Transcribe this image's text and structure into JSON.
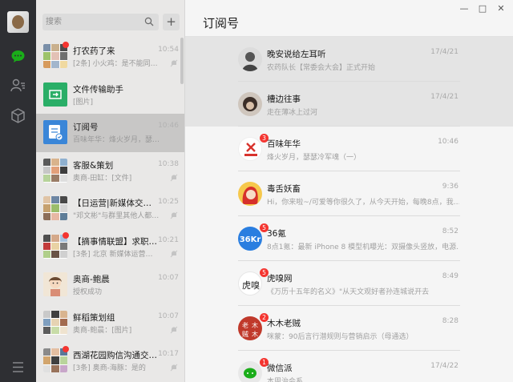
{
  "sidebar": {
    "icons": [
      "avatar",
      "chat-icon",
      "contacts-icon",
      "favorites-icon",
      "menu-icon"
    ]
  },
  "search": {
    "placeholder": "搜索"
  },
  "add_button": "+",
  "conversations": [
    {
      "name": "打农药了来",
      "preview": "[2条] 小火鸡：是不能同…",
      "time": "10:54",
      "muted": true,
      "dot": true
    },
    {
      "name": "文件传输助手",
      "preview": "[图片]",
      "time": "",
      "muted": false,
      "dot": false
    },
    {
      "name": "订阅号",
      "preview": "百味年华：烽火岁月，瑟…",
      "time": "10:46",
      "muted": false,
      "dot": false,
      "selected": true
    },
    {
      "name": "客服&策划",
      "preview": "奥商-田缸：[文件]",
      "time": "10:38",
      "muted": true,
      "dot": false
    },
    {
      "name": "【日运营|新媒体交…",
      "preview": "\"邓文彬\"与群里其他人都…",
      "time": "10:25",
      "muted": true,
      "dot": false
    },
    {
      "name": "【摘事情联盟】求职…",
      "preview": "[3条] 北京 新媒体运营…",
      "time": "10:21",
      "muted": true,
      "dot": true
    },
    {
      "name": "奥商-鲍晨",
      "preview": "授权成功",
      "time": "10:07",
      "muted": false,
      "dot": false
    },
    {
      "name": "鲜稻策划组",
      "preview": "奥商-鲍晨：[图片]",
      "time": "10:07",
      "muted": true,
      "dot": false
    },
    {
      "name": "西湖花园购信沟通交…",
      "preview": "[3条] 奥商-海豚：是的",
      "time": "10:17",
      "muted": true,
      "dot": true
    }
  ],
  "window_controls": [
    "—",
    "□",
    "✕"
  ],
  "main": {
    "title": "订阅号",
    "accounts": [
      {
        "name": "晚安说给左耳听",
        "message": "农药队长【常委会大会】正式开始",
        "time": "17/4/21",
        "badge": ""
      },
      {
        "name": "槽边往事",
        "message": "走在薄冰上过河",
        "time": "17/4/21",
        "badge": ""
      },
      {
        "name": "百味年华",
        "message": "烽火岁月，瑟瑟冷军魂（一）",
        "time": "10:46",
        "badge": "3"
      },
      {
        "name": "毒舌妖畜",
        "message": "Hi，你来啦~/可爱等你很久了，从今天开始，每晚8点，我…",
        "time": "9:36",
        "badge": ""
      },
      {
        "name": "36氪",
        "message": "8点1氪：最新 iPhone 8 模型机曝光：双摄像头竖放，电源…",
        "time": "8:52",
        "badge": "5"
      },
      {
        "name": "虎嗅网",
        "message": "《万历十五年的名义》\"从天文观好者孙连城说开去",
        "time": "8:49",
        "badge": "5"
      },
      {
        "name": "木木老贼",
        "message": "咪蒙：90后言行潜规则与营销启示（母通选）",
        "time": "8:28",
        "badge": "2"
      },
      {
        "name": "微信派",
        "message": "本周治会系",
        "time": "17/4/22",
        "badge": "1"
      }
    ]
  },
  "colors": {
    "rail_bg": "#2e2f33",
    "chat_active": "#1aad19",
    "list_bg": "#e9e8e7",
    "selected_bg": "#c8c7c6",
    "badge_red": "#f43530"
  }
}
